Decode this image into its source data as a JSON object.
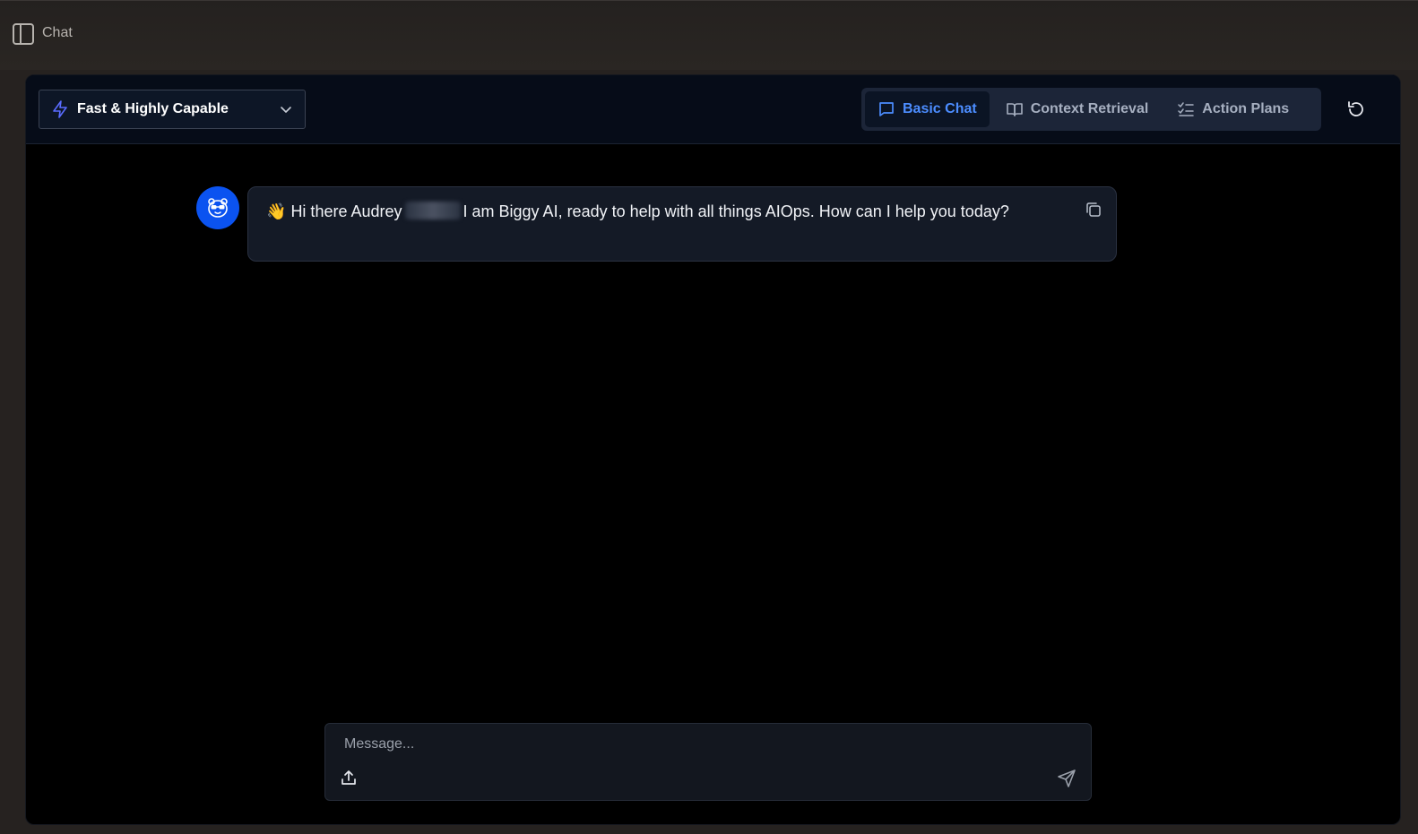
{
  "topbar": {
    "title": "Chat",
    "toggle_icon": "sidebar-panel-icon"
  },
  "header": {
    "model_select": {
      "icon": "lightning-bolt-icon",
      "selected": "Fast & Highly Capable",
      "chevron_icon": "chevron-down-icon"
    },
    "mode_tabs": [
      {
        "label": "Basic Chat",
        "icon": "message-square-icon",
        "active": true
      },
      {
        "label": "Context Retrieval",
        "icon": "open-book-icon",
        "active": false
      },
      {
        "label": "Action Plans",
        "icon": "checklist-icon",
        "active": false
      }
    ],
    "refresh_icon": "refresh-icon"
  },
  "messages": [
    {
      "sender": "assistant",
      "avatar_icon": "bear-glasses-icon",
      "greeting_emoji": "👋",
      "text_before": "Hi there Audrey",
      "text_after": "I am Biggy AI, ready to help with all things AIOps. How can I help you today?",
      "copy_icon": "copy-icon"
    }
  ],
  "composer": {
    "placeholder": "Message...",
    "value": "",
    "upload_icon": "upload-icon",
    "send_icon": "send-icon"
  },
  "colors": {
    "accent": "#4c8dff",
    "avatar_bg": "#0b53f0",
    "panel_bg": "#000000",
    "header_bg": "#060c18"
  }
}
